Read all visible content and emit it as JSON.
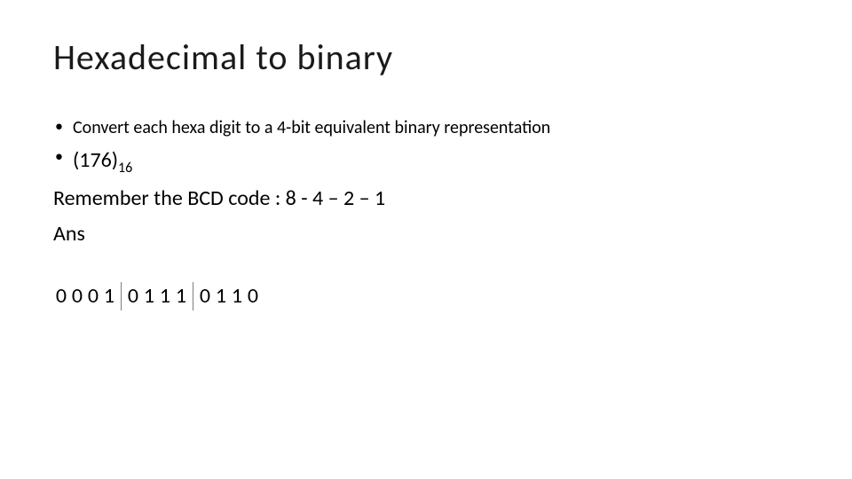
{
  "title": "Hexadecimal  to binary",
  "bullet1": "Convert each hexa digit to a 4-bit equivalent binary representation",
  "bullet2_pre": "(176)",
  "bullet2_sub": "16",
  "line_remember": "Remember the BCD code :   8 - 4 – 2 – 1",
  "line_ans": "Ans",
  "bits": {
    "g1b1": "0",
    "g1b2": "0",
    "g1b3": "0",
    "g1b4": "1",
    "g2b1": "0",
    "g2b2": "1",
    "g2b3": "1",
    "g2b4": "1",
    "g3b1": "0",
    "g3b2": "1",
    "g3b3": "1",
    "g3b4": "0"
  }
}
